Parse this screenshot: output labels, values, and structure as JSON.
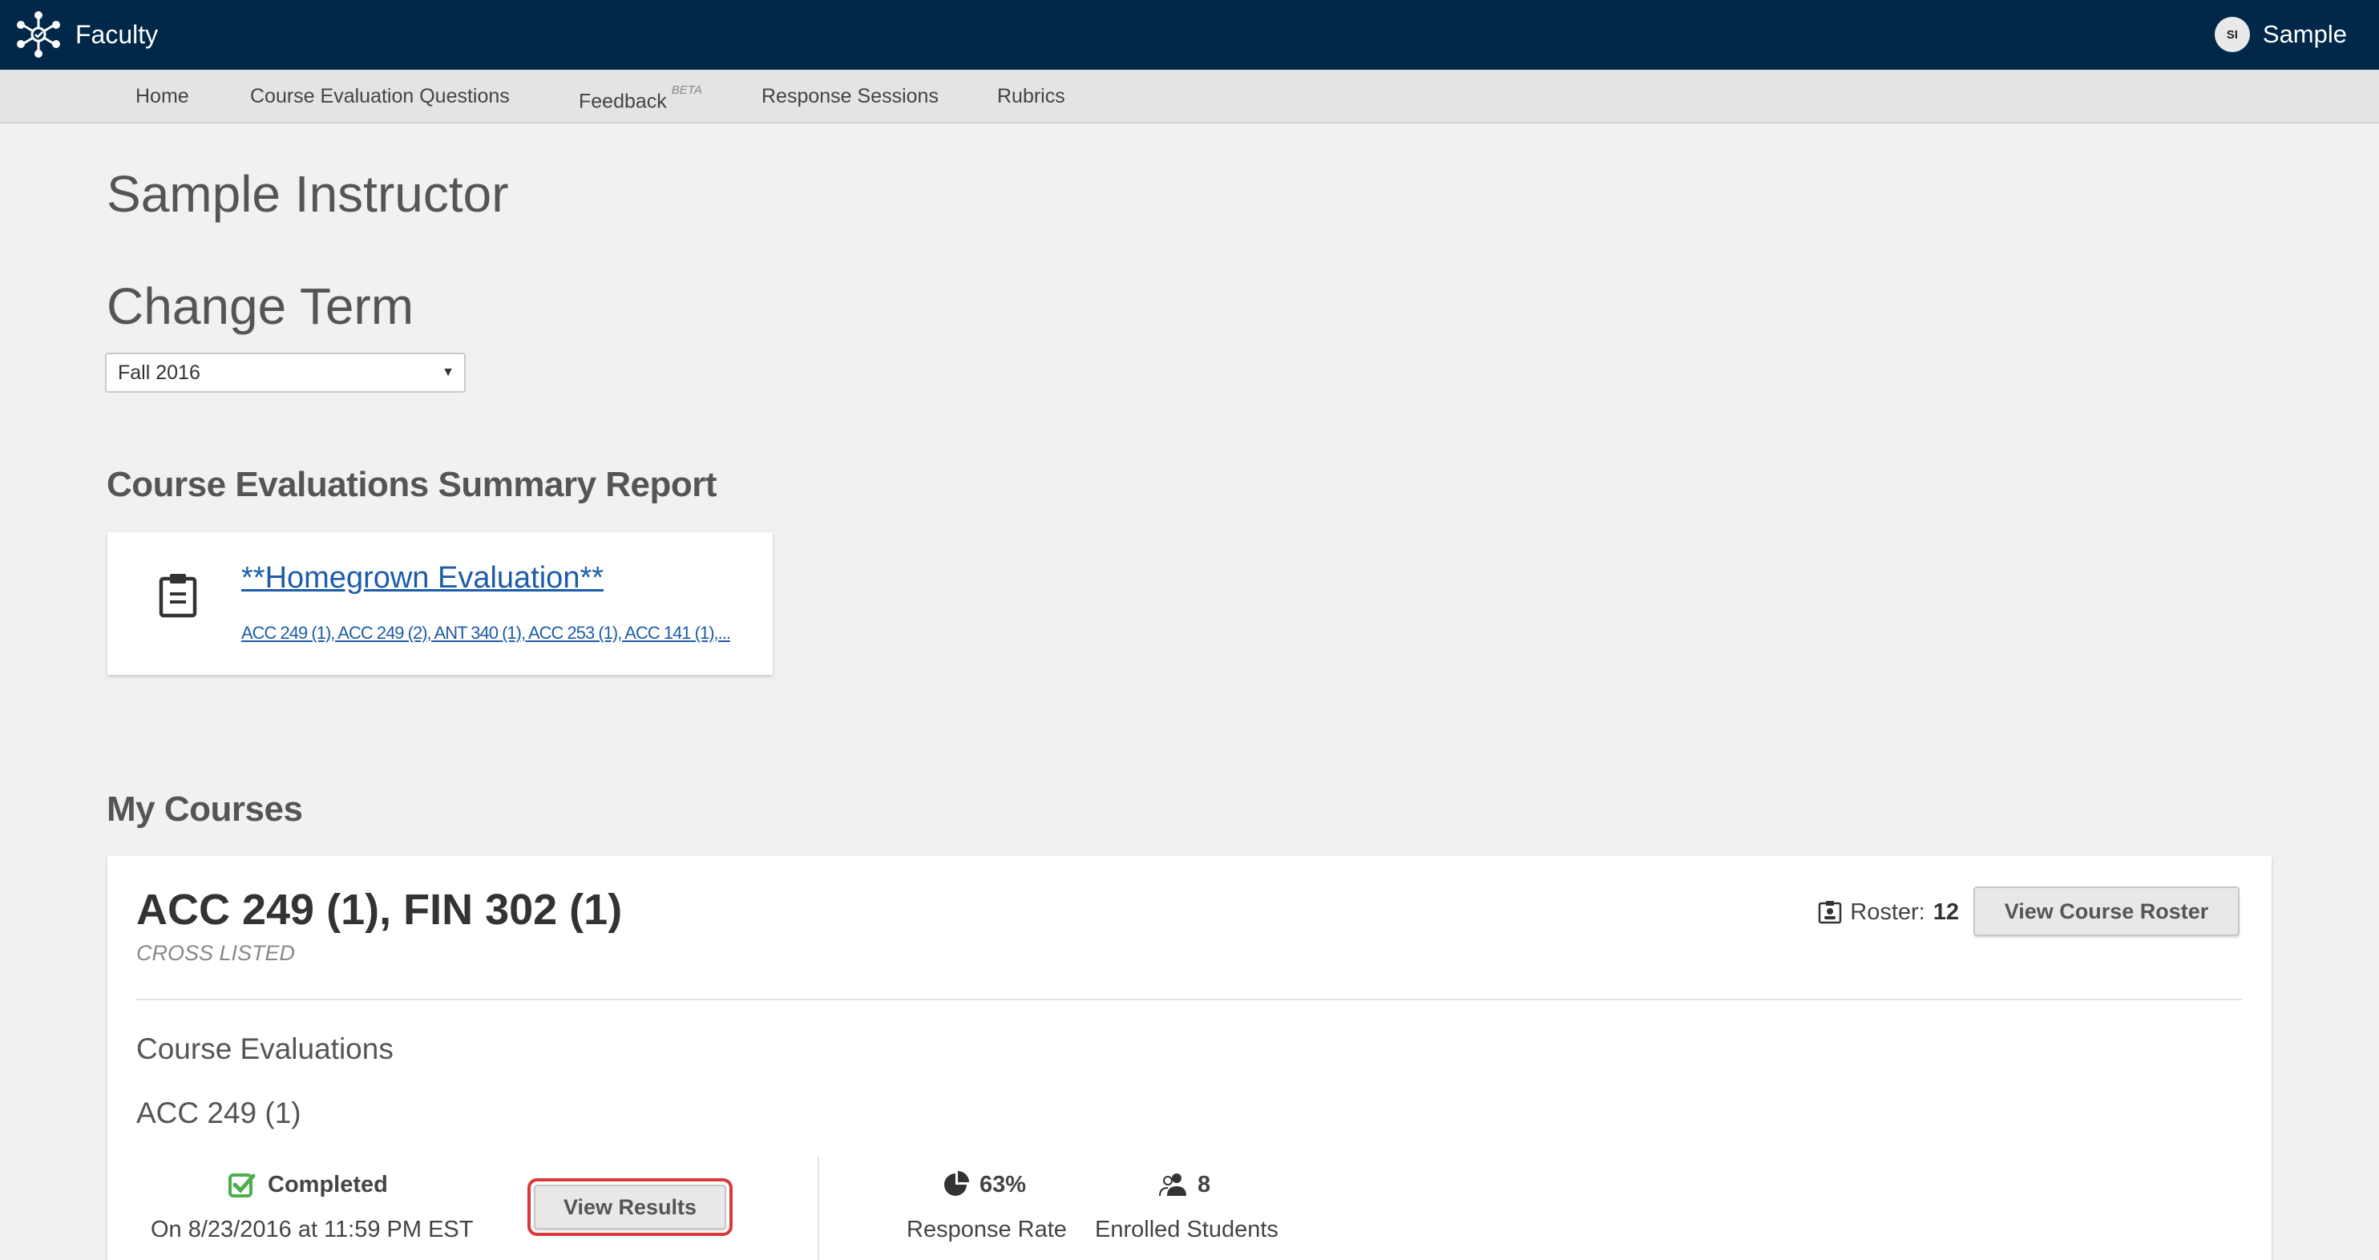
{
  "header": {
    "app_name": "Faculty",
    "user_initials": "SI",
    "user_name": "Sample"
  },
  "nav": {
    "items": [
      {
        "label": "Home"
      },
      {
        "label": "Course Evaluation Questions"
      },
      {
        "label": "Feedback",
        "badge": "BETA"
      },
      {
        "label": "Response Sessions"
      },
      {
        "label": "Rubrics"
      }
    ]
  },
  "page": {
    "title": "Sample Instructor",
    "term_heading": "Change Term",
    "term_selected": "Fall 2016"
  },
  "summary": {
    "heading": "Course Evaluations Summary Report",
    "report_title": "**Homegrown Evaluation**",
    "report_courses": "ACC 249 (1), ACC 249 (2), ANT 340 (1), ACC 253 (1), ACC 141 (1),..."
  },
  "my_courses": {
    "heading": "My Courses",
    "course": {
      "title": "ACC 249 (1), FIN 302 (1)",
      "subtitle": "CROSS LISTED",
      "roster_label": "Roster:",
      "roster_count": "12",
      "view_roster_label": "View Course Roster",
      "evaluations_heading": "Course Evaluations",
      "section_name": "ACC 249 (1)",
      "status": "Completed",
      "status_date": "On 8/23/2016 at 11:59 PM EST",
      "view_results_label": "View Results",
      "response_rate": "63%",
      "response_rate_label": "Response Rate",
      "enrolled": "8",
      "enrolled_label": "Enrolled Students"
    }
  },
  "colors": {
    "topbar": "#012849",
    "link": "#1d5ca8",
    "check": "#4cae4c",
    "highlight": "#d9393a"
  }
}
